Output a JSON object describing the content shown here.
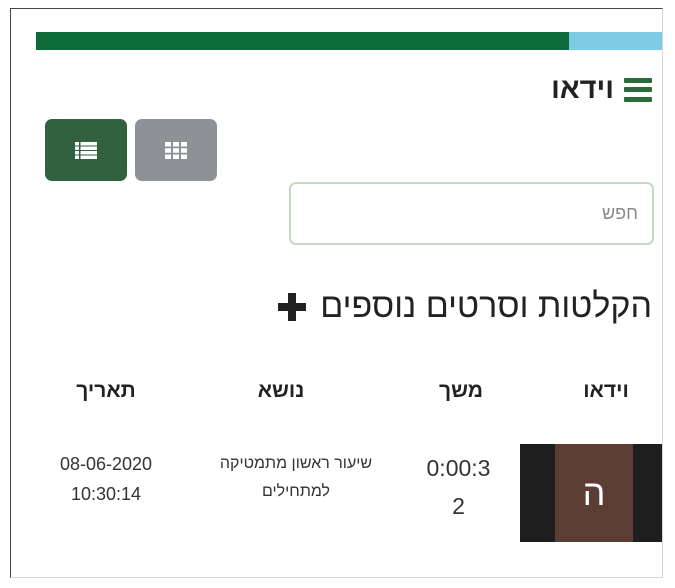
{
  "progress": {
    "value": 0.85,
    "fill_color": "#0e6b3a",
    "track_color": "#7ecbe8"
  },
  "header": {
    "icon": "hamburger-icon",
    "title": "וידאו"
  },
  "view_toggle": {
    "list_icon": "list-icon",
    "grid_icon": "grid-icon",
    "active": "list"
  },
  "search": {
    "placeholder": "חפש",
    "value": ""
  },
  "section": {
    "title": "הקלטות וסרטים נוספים",
    "add_icon": "plus-icon"
  },
  "table": {
    "headers": {
      "video": "וידאו",
      "duration": "משך",
      "topic": "נושא",
      "date": "תאריך"
    },
    "rows": [
      {
        "thumbnail_letter": "ה",
        "duration_line1": "0:00:3",
        "duration_line2": "2",
        "topic_line1": "שיעור ראשון מתמטיקה",
        "topic_line2": "למתחילים",
        "date": "08-06-2020",
        "time": "10:30:14"
      }
    ]
  }
}
